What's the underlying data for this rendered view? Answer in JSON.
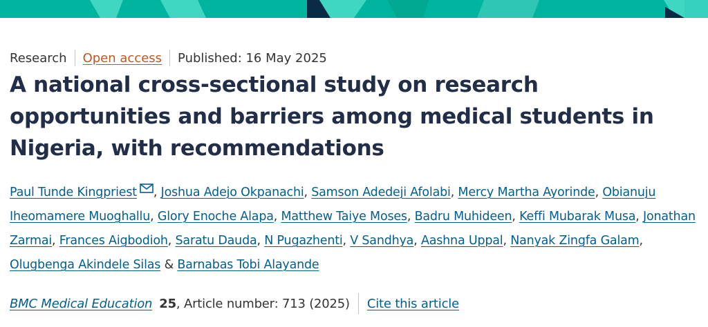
{
  "banner": {
    "color": "#00b5a0",
    "accent": "#36d1bd",
    "dark": "#0a2b45"
  },
  "meta": {
    "type": "Research",
    "access": "Open access",
    "published": "Published: 16 May 2025"
  },
  "article": {
    "title": "A national cross-sectional study on research opportunities and barriers among medical students in Nigeria, with recommendations"
  },
  "authors": {
    "list": [
      "Paul Tunde Kingpriest",
      "Joshua Adejo Okpanachi",
      "Samson Adedeji Afolabi",
      "Mercy Martha Ayorinde",
      "Obianuju Iheomamere Muoghallu",
      "Glory Enoche Alapa",
      "Matthew Taiye Moses",
      "Badru Muhideen",
      "Keffi Mubarak Musa",
      "Jonathan Zarmai",
      "Frances Aigbodioh",
      "Saratu Dauda",
      "N Pugazhenti",
      "V Sandhya",
      "Aashna Uppal",
      "Nanyak Zingfa Galam",
      "Olugbenga Akindele Silas",
      "Barnabas Tobi Alayande"
    ],
    "separator": ", ",
    "final_separator": " & ",
    "mail_icon": "envelope-icon"
  },
  "citation": {
    "journal": "BMC Medical Education",
    "volume": "25",
    "article_info": ", Article number: 713 (2025)",
    "cite_label": "Cite this article"
  },
  "colors": {
    "link": "#025e8d",
    "title": "#222d48",
    "open_access": "#c05621"
  }
}
